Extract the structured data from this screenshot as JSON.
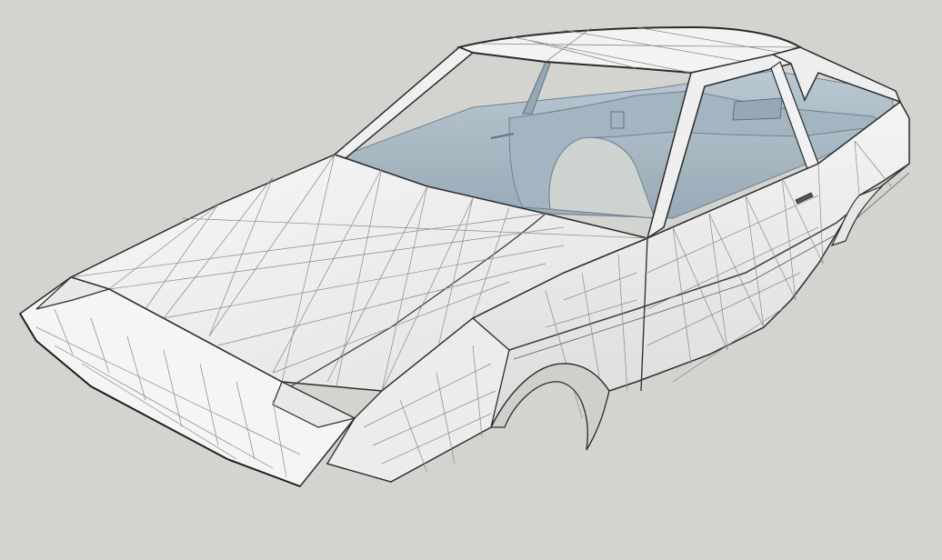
{
  "viewport": {
    "background_color": "#d3d3cf",
    "model_surface_color": "#f2f2f2",
    "model_shadow_color": "#dcdcdc",
    "interior_color": "#a9bac5",
    "interior_dark_color": "#8fa2ae",
    "edge_color": "#2b2b2b",
    "mesh_color": "#7a7a7a",
    "subject": "car-body-wireframe-model"
  }
}
